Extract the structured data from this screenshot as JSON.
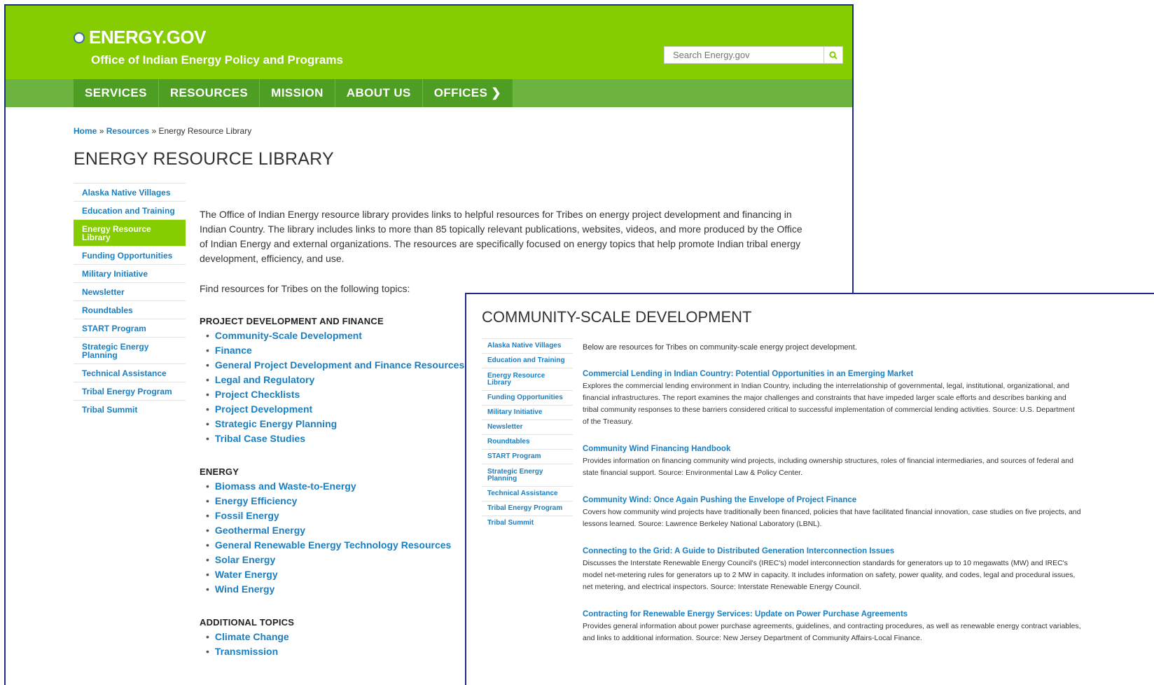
{
  "page1": {
    "logo": "ENERGY.GOV",
    "office": "Office of Indian Energy Policy and Programs",
    "search": {
      "placeholder": "Search Energy.gov"
    },
    "nav": [
      "SERVICES",
      "RESOURCES",
      "MISSION",
      "ABOUT US",
      "OFFICES ❯"
    ],
    "breadcrumb": {
      "home": "Home",
      "sep1": "»",
      "resources": "Resources",
      "sep2": "»",
      "current": "Energy Resource Library"
    },
    "title": "ENERGY RESOURCE LIBRARY",
    "sidenav": [
      "Alaska Native Villages",
      "Education and Training",
      "Energy Resource Library",
      "Funding Opportunities",
      "Military Initiative",
      "Newsletter",
      "Roundtables",
      "START Program",
      "Strategic Energy Planning",
      "Technical Assistance",
      "Tribal Energy Program",
      "Tribal Summit"
    ],
    "intro": "The Office of Indian Energy resource library provides links to helpful resources for Tribes on energy project development and financing in Indian Country. The library includes links to more than 85 topically relevant publications, websites, videos, and more produced by the Office of Indian Energy and external organizations. The resources are specifically focused on energy topics that help promote Indian tribal energy development, efficiency, and use.",
    "find": "Find resources for Tribes on the following topics:",
    "sections": [
      {
        "heading": "PROJECT DEVELOPMENT AND FINANCE",
        "items": [
          "Community-Scale Development",
          "Finance",
          "General Project Development and Finance Resources",
          "Legal and Regulatory",
          "Project Checklists",
          "Project Development",
          "Strategic Energy Planning",
          "Tribal Case Studies"
        ]
      },
      {
        "heading": "ENERGY",
        "items": [
          "Biomass and Waste-to-Energy",
          "Energy Efficiency",
          "Fossil Energy",
          "Geothermal Energy",
          "General Renewable Energy Technology Resources",
          "Solar Energy",
          "Water Energy",
          "Wind Energy"
        ]
      },
      {
        "heading": "ADDITIONAL TOPICS",
        "items": [
          "Climate Change",
          "Transmission"
        ]
      }
    ]
  },
  "page2": {
    "title": "COMMUNITY-SCALE DEVELOPMENT",
    "intro": "Below are resources for Tribes on community-scale energy project development.",
    "resources": [
      {
        "title": "Commercial Lending in Indian Country: Potential Opportunities in an Emerging Market",
        "desc": "Explores the commercial lending environment in Indian Country, including the interrelationship of governmental, legal, institutional, organizational, and financial infrastructures. The report examines the major challenges and constraints that have impeded larger scale efforts and describes banking and tribal community responses to these barriers considered critical to successful implementation of commercial lending activities. Source: U.S. Department of the Treasury."
      },
      {
        "title": "Community Wind Financing Handbook",
        "desc": "Provides information on financing community wind projects, including ownership structures, roles of financial intermediaries, and sources of federal and state financial support. Source: Environmental Law & Policy Center."
      },
      {
        "title": "Community Wind: Once Again Pushing the Envelope of Project Finance",
        "desc": "Covers how community wind projects have traditionally been financed, policies that have facilitated financial innovation, case studies on five projects, and lessons learned. Source: Lawrence Berkeley National Laboratory (LBNL)."
      },
      {
        "title": "Connecting to the Grid: A Guide to Distributed Generation Interconnection Issues",
        "desc": "Discusses the Interstate Renewable Energy Council's (IREC's) model interconnection standards for generators up to 10 megawatts (MW) and IREC's model net-metering rules for generators up to 2 MW in capacity. It includes information on safety, power quality, and codes, legal and procedural issues, net metering, and electrical inspectors. Source: Interstate Renewable Energy Council."
      },
      {
        "title": "Contracting for Renewable Energy Services: Update on Power Purchase Agreements",
        "desc": "Provides general information about power purchase agreements, guidelines, and contracting procedures, as well as renewable energy contract variables, and links to additional information. Source: New Jersey Department of Community Affairs-Local Finance."
      }
    ]
  },
  "colors": {
    "brand_green": "#85cc00",
    "nav_green": "#4e9e23",
    "link_blue": "#1a7fc1",
    "frame_blue": "#1f2b8f"
  },
  "icons": {
    "search": "search-icon",
    "seal": "doe-seal-icon"
  }
}
